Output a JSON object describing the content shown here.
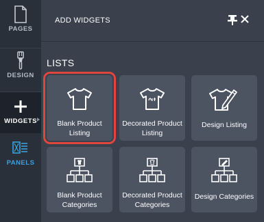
{
  "sidebar": {
    "items": [
      {
        "label": "PAGES",
        "icon": "page-icon"
      },
      {
        "label": "DESIGN",
        "icon": "paintbrush-icon"
      },
      {
        "label": "WIDGETS",
        "icon": "plus-icon",
        "active": true
      },
      {
        "label": "PANELS",
        "icon": "panels-icon"
      }
    ]
  },
  "panel": {
    "title": "ADD WIDGETS",
    "pin_icon": "pin-icon",
    "close_icon": "close-icon"
  },
  "section": {
    "title": "LISTS"
  },
  "widgets": [
    {
      "label": "Blank Product Listing",
      "icon": "tshirt-icon",
      "selected": true
    },
    {
      "label": "Decorated Product Listing",
      "icon": "tshirt-art-icon"
    },
    {
      "label": "Design Listing",
      "icon": "tshirt-pencil-icon"
    },
    {
      "label": "Blank Product Categories",
      "icon": "blank-category-tree-icon"
    },
    {
      "label": "Decorated Product Categories",
      "icon": "decorated-category-tree-icon"
    },
    {
      "label": "Design Categories",
      "icon": "design-category-tree-icon"
    }
  ],
  "colors": {
    "highlight": "#e0453e",
    "panels_accent": "#3aa0e0"
  }
}
